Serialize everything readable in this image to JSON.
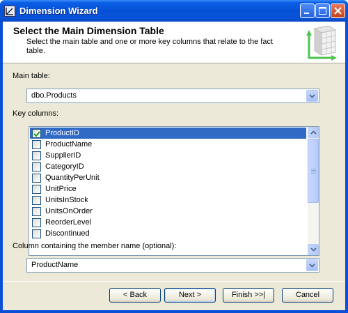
{
  "window": {
    "title": "Dimension Wizard"
  },
  "header": {
    "title": "Select the Main Dimension Table",
    "description": "Select the main table and one or more key columns that relate to the fact table."
  },
  "main_table": {
    "label": "Main table:",
    "value": "dbo.Products"
  },
  "key_columns": {
    "label": "Key columns:",
    "items": [
      {
        "label": "ProductID",
        "checked": true,
        "selected": true
      },
      {
        "label": "ProductName",
        "checked": false
      },
      {
        "label": "SupplierID",
        "checked": false
      },
      {
        "label": "CategoryID",
        "checked": false
      },
      {
        "label": "QuantityPerUnit",
        "checked": false
      },
      {
        "label": "UnitPrice",
        "checked": false
      },
      {
        "label": "UnitsInStock",
        "checked": false
      },
      {
        "label": "UnitsOnOrder",
        "checked": false
      },
      {
        "label": "ReorderLevel",
        "checked": false
      },
      {
        "label": "Discontinued",
        "checked": false
      }
    ]
  },
  "member_name": {
    "label": "Column containing the member name (optional):",
    "value": "ProductName"
  },
  "buttons": {
    "back": "< Back",
    "next": "Next >",
    "finish": "Finish >>|",
    "cancel": "Cancel"
  },
  "colors": {
    "titlebar": "#0551d6",
    "selection": "#316ac5",
    "dialog_bg": "#ece9d8"
  }
}
